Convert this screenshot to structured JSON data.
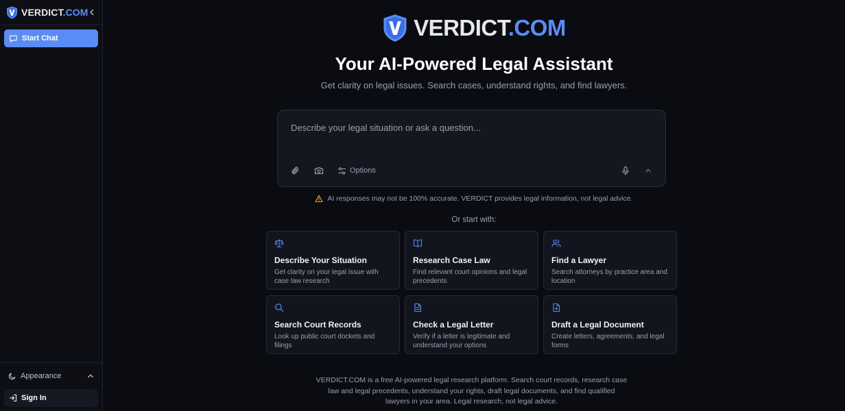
{
  "brand": {
    "name_main": "VERDICT",
    "name_domain": ".COM",
    "accent": "#5b8cf5"
  },
  "sidebar": {
    "collapse_icon": "chevron-left-icon",
    "start_chat_label": "Start Chat",
    "appearance_label": "Appearance",
    "signin_label": "Sign In"
  },
  "hero": {
    "title": "Your AI-Powered Legal Assistant",
    "subtitle": "Get clarity on legal issues. Search cases, understand rights, and find lawyers."
  },
  "chat": {
    "placeholder": "Describe your legal situation or ask a question...",
    "options_label": "Options"
  },
  "disclaimer": "AI responses may not be 100% accurate. VERDICT provides legal information, not legal advice.",
  "or_start": "Or start with:",
  "cards": [
    {
      "icon": "scale-icon",
      "title": "Describe Your Situation",
      "desc": "Get clarity on your legal issue with case law research"
    },
    {
      "icon": "book-icon",
      "title": "Research Case Law",
      "desc": "Find relevant court opinions and legal precedents"
    },
    {
      "icon": "users-icon",
      "title": "Find a Lawyer",
      "desc": "Search attorneys by practice area and location"
    },
    {
      "icon": "search-icon",
      "title": "Search Court Records",
      "desc": "Look up public court dockets and filings"
    },
    {
      "icon": "document-icon",
      "title": "Check a Legal Letter",
      "desc": "Verify if a letter is legitimate and understand your options"
    },
    {
      "icon": "file-plus-icon",
      "title": "Draft a Legal Document",
      "desc": "Create letters, agreements, and legal forms"
    }
  ],
  "footer": "VERDICT.COM is a free AI-powered legal research platform. Search court records, research case law and legal precedents, understand your rights, draft legal documents, and find qualified lawyers in your area. Legal research, not legal advice."
}
